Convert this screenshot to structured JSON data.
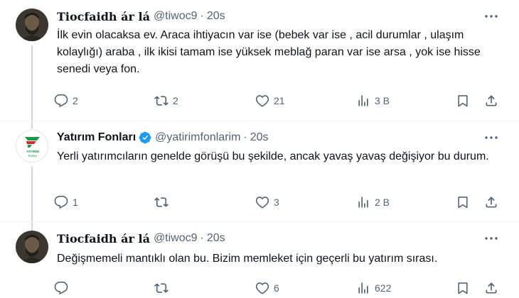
{
  "tweets": [
    {
      "name": "Tiocfaidh ár lá",
      "handle": "@tiwoc9",
      "separator": "·",
      "time": "20s",
      "text": "İlk evin olacaksa ev. Araca ihtiyacın var ise (bebek var ise , acil durumlar , ulaşım kolaylığı) araba , ilk ikisi tamam ise yüksek meblağ paran var ise arsa , yok ise hisse senedi veya fon.",
      "replies": "2",
      "retweets": "2",
      "likes": "21",
      "views": "3 B"
    },
    {
      "name": "Yatırım Fonları",
      "handle": "@yatirimfonlarim",
      "separator": "·",
      "time": "20s",
      "text": "Yerli yatırımcıların genelde görüşü bu şekilde, ancak yavaş yavaş değişiyor bu durum.",
      "replies": "1",
      "retweets": "",
      "likes": "3",
      "views": "2 B",
      "logo_text": "YATIRIM fonları"
    },
    {
      "name": "Tiocfaidh ár lá",
      "handle": "@tiwoc9",
      "separator": "·",
      "time": "20s",
      "text": "Değişmemeli mantıklı olan bu. Bizim memleket için geçerli bu yatırım sırası.",
      "replies": "",
      "retweets": "",
      "likes": "6",
      "views": "622"
    }
  ],
  "colors": {
    "text": "#0f1419",
    "secondary": "#536471",
    "verified": "#1d9bf0",
    "brand_green": "#1a9a4a",
    "brand_red": "#d6282f",
    "thread_line": "#cfd9de"
  }
}
